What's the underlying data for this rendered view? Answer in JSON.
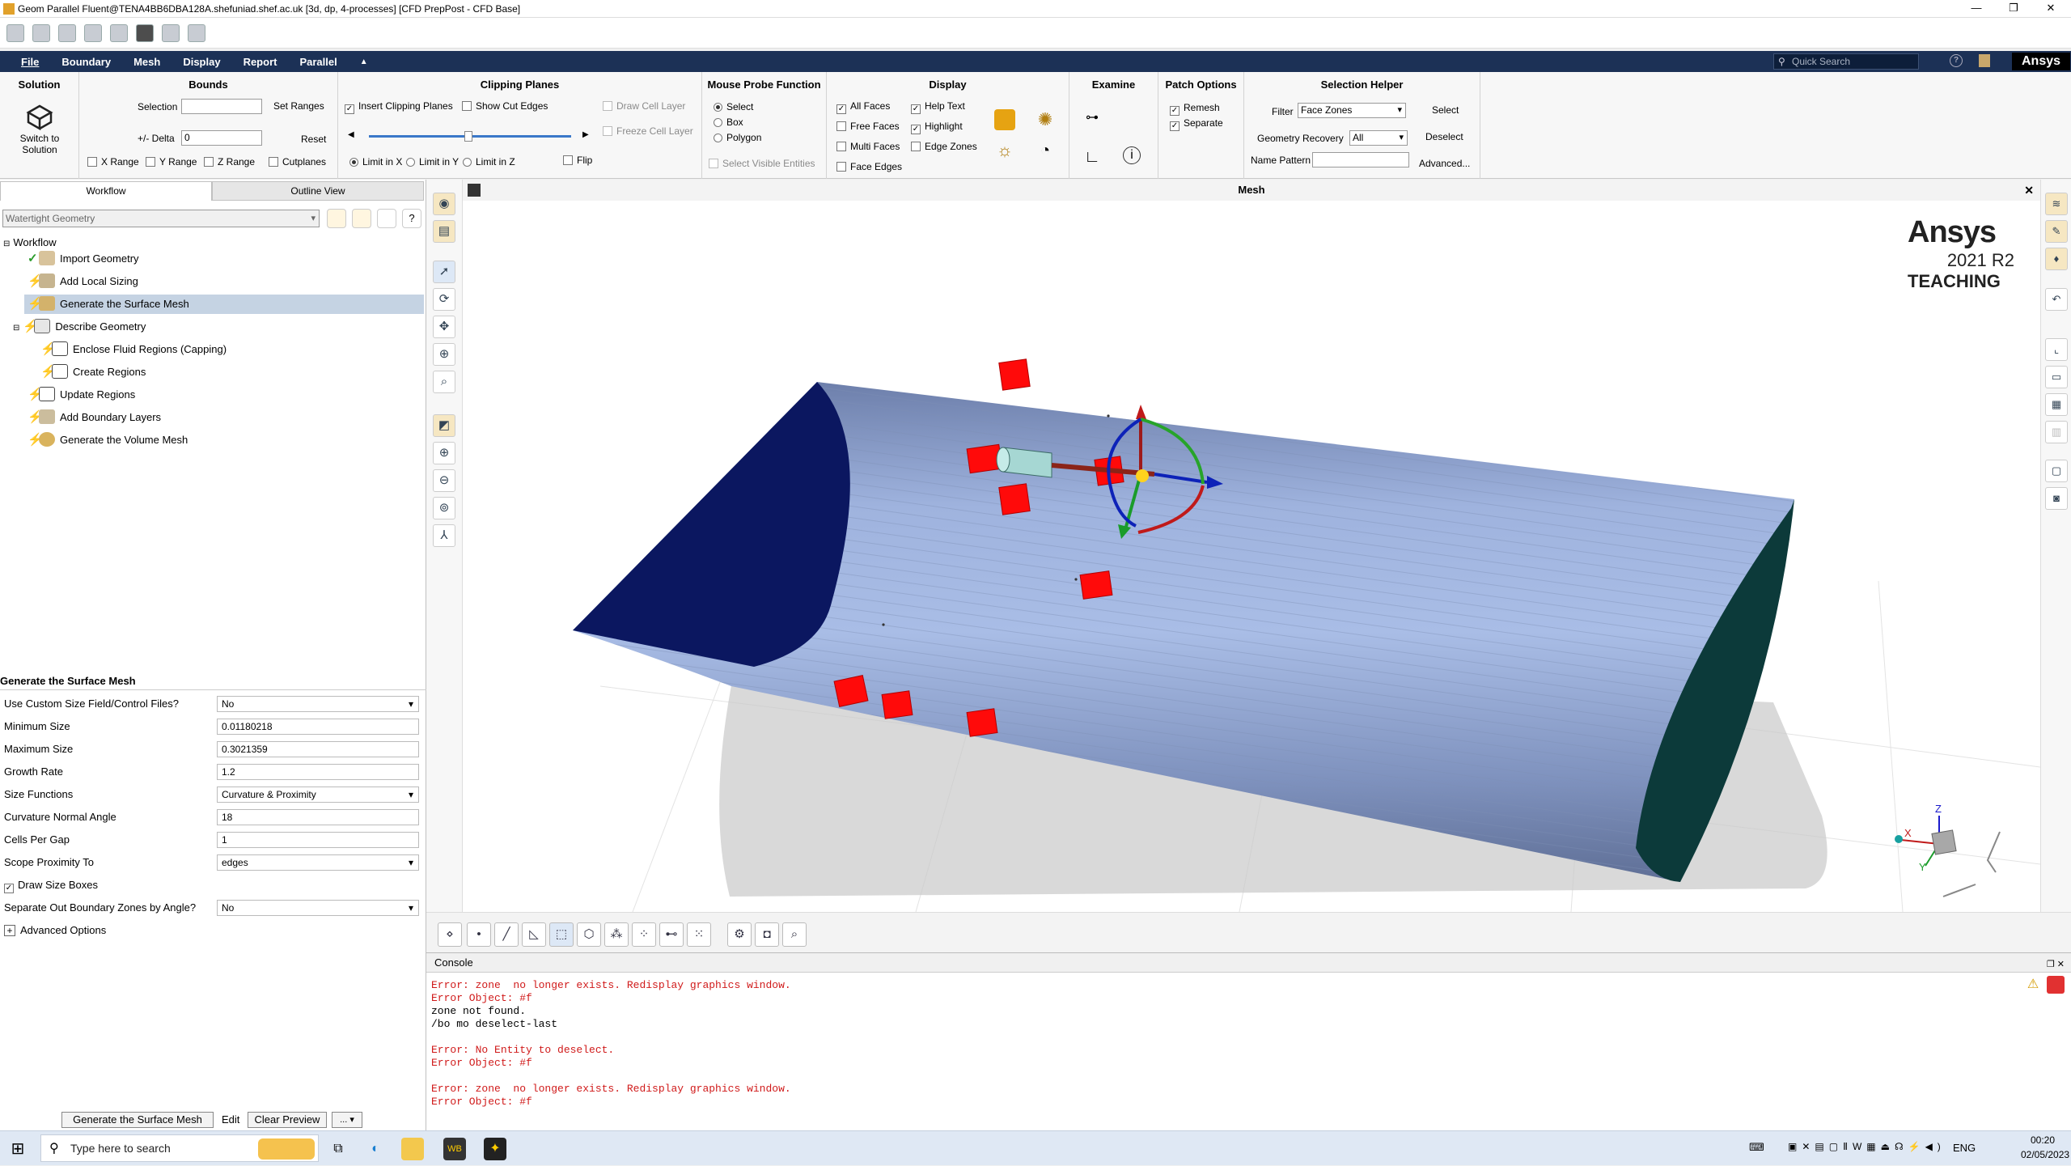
{
  "window": {
    "title": "Geom Parallel Fluent@TENA4BB6DBA128A.shefuniad.shef.ac.uk  [3d, dp, 4-processes] [CFD PrepPost - CFD Base]",
    "minimize": "—",
    "restore": "❐",
    "close": "✕"
  },
  "menu": {
    "items": [
      "File",
      "Boundary",
      "Mesh",
      "Display",
      "Report",
      "Parallel",
      "▲"
    ],
    "quick_search": "Quick Search",
    "brand": "Ansys"
  },
  "ribbon": {
    "solution": {
      "title": "Solution",
      "switch_label_1": "Switch to",
      "switch_label_2": "Solution"
    },
    "bounds": {
      "title": "Bounds",
      "selection_label": "Selection",
      "set_ranges": "Set Ranges",
      "delta_label": "+/- Delta",
      "delta_value": "0",
      "reset": "Reset",
      "x_range": "X Range",
      "y_range": "Y Range",
      "z_range": "Z Range",
      "cutplanes": "Cutplanes"
    },
    "clipping": {
      "title": "Clipping Planes",
      "insert": "Insert Clipping Planes",
      "show_cut_edges": "Show Cut Edges",
      "draw_cell_layer": "Draw Cell Layer",
      "freeze_cell_layer": "Freeze Cell Layer",
      "limit_x": "Limit in X",
      "limit_y": "Limit in Y",
      "limit_z": "Limit in Z",
      "flip": "Flip"
    },
    "probe": {
      "title": "Mouse Probe Function",
      "select": "Select",
      "box": "Box",
      "polygon": "Polygon",
      "select_visible": "Select Visible Entities"
    },
    "display": {
      "title": "Display",
      "all_faces": "All Faces",
      "free_faces": "Free Faces",
      "multi_faces": "Multi Faces",
      "face_edges": "Face Edges",
      "help_text": "Help Text",
      "highlight": "Highlight",
      "edge_zones": "Edge Zones"
    },
    "examine": {
      "title": "Examine"
    },
    "patch": {
      "title": "Patch Options",
      "remesh": "Remesh",
      "separate": "Separate"
    },
    "selhelper": {
      "title": "Selection Helper",
      "filter_label": "Filter",
      "filter_value": "Face Zones",
      "select": "Select",
      "geom_recovery_label": "Geometry Recovery",
      "geom_recovery_value": "All",
      "deselect": "Deselect",
      "name_pattern_label": "Name Pattern",
      "advanced": "Advanced..."
    }
  },
  "left": {
    "tabs": [
      "Workflow",
      "Outline View"
    ],
    "workflow_type": "Watertight Geometry",
    "tree": {
      "root": "Workflow",
      "items": [
        "Import Geometry",
        "Add Local Sizing",
        "Generate the Surface Mesh",
        "Describe Geometry",
        "Enclose Fluid Regions (Capping)",
        "Create Regions",
        "Update Regions",
        "Add Boundary Layers",
        "Generate the Volume Mesh"
      ]
    },
    "task": {
      "title": "Generate the Surface Mesh",
      "props": [
        {
          "label": "Use Custom Size Field/Control Files?",
          "value": "No"
        },
        {
          "label": "Minimum Size",
          "value": "0.01180218"
        },
        {
          "label": "Maximum Size",
          "value": "0.3021359"
        },
        {
          "label": "Growth Rate",
          "value": "1.2"
        },
        {
          "label": "Size Functions",
          "value": "Curvature & Proximity"
        },
        {
          "label": "Curvature Normal Angle",
          "value": "18"
        },
        {
          "label": "Cells Per Gap",
          "value": "1"
        },
        {
          "label": "Scope Proximity To",
          "value": "edges"
        },
        {
          "label": "Draw Size Boxes",
          "value": ""
        },
        {
          "label": "Separate Out Boundary Zones by Angle?",
          "value": "No"
        }
      ],
      "advanced": "Advanced Options",
      "btn_generate": "Generate the Surface Mesh",
      "btn_edit": "Edit",
      "btn_clear": "Clear Preview",
      "btn_more": "... ▾"
    }
  },
  "graphics": {
    "title": "Mesh",
    "logo": "Ansys",
    "version": "2021 R2",
    "edition": "TEACHING",
    "close": "✕"
  },
  "console": {
    "title": "Console",
    "lines": [
      {
        "t": "Error: zone  no longer exists. Redisplay graphics window.",
        "e": true
      },
      {
        "t": "Error Object: #f",
        "e": true
      },
      {
        "t": "zone not found.",
        "e": false
      },
      {
        "t": "/bo mo deselect-last",
        "e": false
      },
      {
        "t": "",
        "e": false
      },
      {
        "t": "Error: No Entity to deselect.",
        "e": true
      },
      {
        "t": "Error Object: #f",
        "e": true
      },
      {
        "t": "",
        "e": false
      },
      {
        "t": "Error: zone  no longer exists. Redisplay graphics window.",
        "e": true
      },
      {
        "t": "Error Object: #f",
        "e": true
      }
    ]
  },
  "taskbar": {
    "search": "Type here to search",
    "lang": "ENG",
    "time": "00:20",
    "date": "02/05/2023"
  },
  "colors": {
    "menubar": "#1c3156",
    "cylinder": "#8fa3cf",
    "end_cap_left": "#0b1760",
    "end_cap_right": "#0c3a3a",
    "size_box": "#ff0000"
  }
}
